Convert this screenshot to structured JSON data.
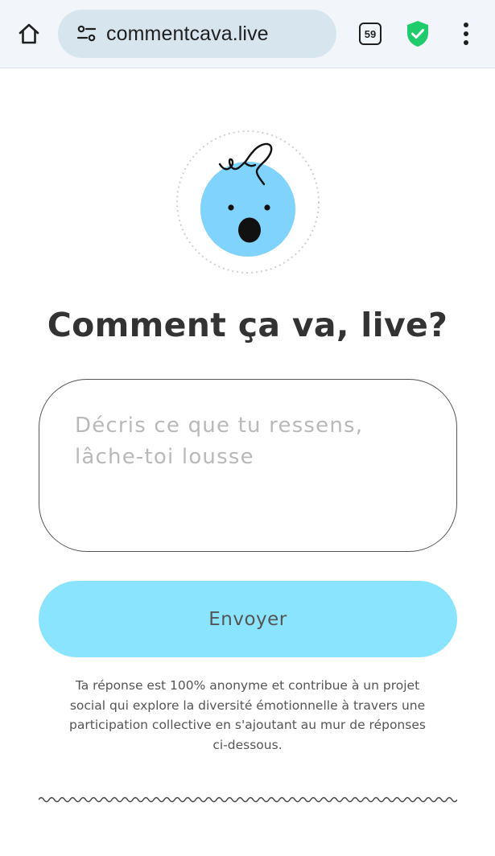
{
  "browser": {
    "url": "commentcava.live",
    "tab_count": "59",
    "icons": [
      "home-icon",
      "site-settings-icon",
      "tab-switcher-icon",
      "shield-check-icon",
      "more-vert-icon"
    ],
    "shield_color": "#1fcc6b"
  },
  "page": {
    "title": "Comment ça va, live?",
    "input_placeholder": "Décris ce que tu ressens, lâche-toi lousse",
    "send_label": "Envoyer",
    "disclaimer": "Ta réponse est 100% anonyme et contribue à un projet social qui explore la diversité émotionnelle à travers une participation collective en s'ajoutant au mur de réponses ci-dessous.",
    "accent_color": "#8be4fd",
    "face_color": "#7fd3fc"
  }
}
